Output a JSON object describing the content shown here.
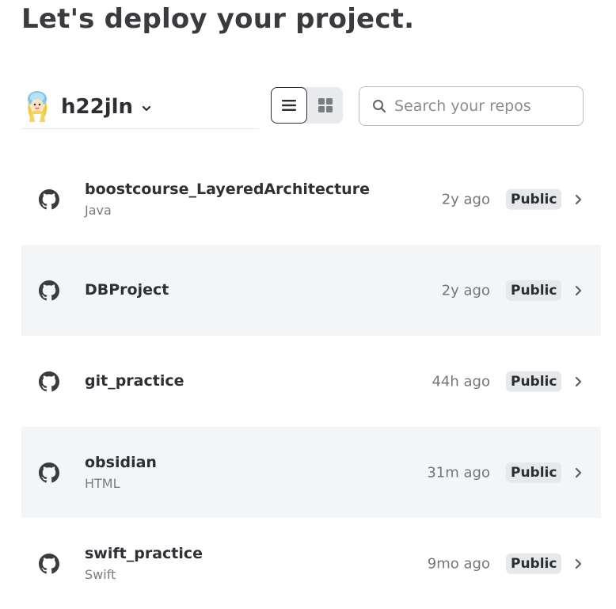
{
  "page": {
    "title": "Let's deploy your project."
  },
  "account": {
    "name": "h22jln",
    "avatar_icon": "avatar-girl-icon",
    "dropdown_icon": "chevron-down-icon"
  },
  "view_toggle": {
    "options": [
      "list-view-icon",
      "grid-view-icon"
    ],
    "selected": "list"
  },
  "search": {
    "placeholder": "Search your repos",
    "value": "",
    "icon": "search-icon"
  },
  "repos": [
    {
      "name": "boostcourse_LayeredArchitecture",
      "language": "Java",
      "updated": "2y ago",
      "visibility": "Public"
    },
    {
      "name": "DBProject",
      "language": "",
      "updated": "2y ago",
      "visibility": "Public"
    },
    {
      "name": "git_practice",
      "language": "",
      "updated": "44h ago",
      "visibility": "Public"
    },
    {
      "name": "obsidian",
      "language": "HTML",
      "updated": "31m ago",
      "visibility": "Public"
    },
    {
      "name": "swift_practice",
      "language": "Swift",
      "updated": "9mo ago",
      "visibility": "Public"
    }
  ],
  "colors": {
    "text": "#2b2d31",
    "muted": "#74767b",
    "alt_row": "#f4f5f7",
    "badge_bg": "#e7e8eb",
    "border": "#b9bbc0"
  }
}
